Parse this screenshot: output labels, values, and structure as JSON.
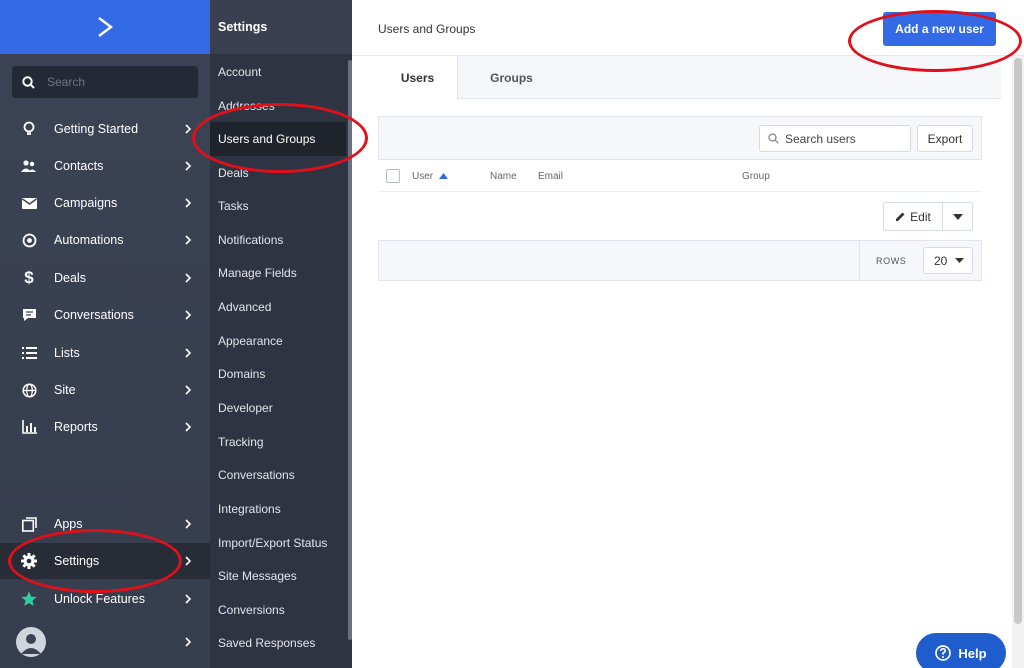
{
  "nav": {
    "search_placeholder": "Search",
    "items": [
      {
        "label": "Getting Started",
        "icon": "lightbulb-icon"
      },
      {
        "label": "Contacts",
        "icon": "contacts-icon"
      },
      {
        "label": "Campaigns",
        "icon": "envelope-icon"
      },
      {
        "label": "Automations",
        "icon": "automation-icon"
      },
      {
        "label": "Deals",
        "icon": "dollar-icon"
      },
      {
        "label": "Conversations",
        "icon": "chat-icon"
      },
      {
        "label": "Lists",
        "icon": "list-icon"
      },
      {
        "label": "Site",
        "icon": "globe-icon"
      },
      {
        "label": "Reports",
        "icon": "bar-chart-icon"
      }
    ],
    "bottom_items": [
      {
        "label": "Apps",
        "icon": "apps-icon"
      },
      {
        "label": "Settings",
        "icon": "gear-icon"
      },
      {
        "label": "Unlock Features",
        "icon": "star-icon"
      }
    ],
    "active": "Settings"
  },
  "subnav": {
    "title": "Settings",
    "items": [
      "Account",
      "Addresses",
      "Users and Groups",
      "Deals",
      "Tasks",
      "Notifications",
      "Manage Fields",
      "Advanced",
      "Appearance",
      "Domains",
      "Developer",
      "Tracking",
      "Conversations",
      "Integrations",
      "Import/Export Status",
      "Site Messages",
      "Conversions",
      "Saved Responses"
    ],
    "active": "Users and Groups"
  },
  "main": {
    "title": "Users and Groups",
    "add_button": "Add a new user",
    "tabs": [
      {
        "label": "Users"
      },
      {
        "label": "Groups"
      }
    ],
    "active_tab": "Users",
    "search_placeholder": "Search users",
    "export_button": "Export",
    "columns": [
      "User",
      "Name",
      "Email",
      "Group"
    ],
    "edit_button": "Edit",
    "rows_label": "ROWS",
    "rows_value": "20"
  },
  "help_button": "Help",
  "colors": {
    "accent": "#356ae6",
    "nav_bg": "#3b4252",
    "subnav_bg": "#2f3442",
    "annotation": "#e0101a",
    "star": "#2ecf9e"
  }
}
